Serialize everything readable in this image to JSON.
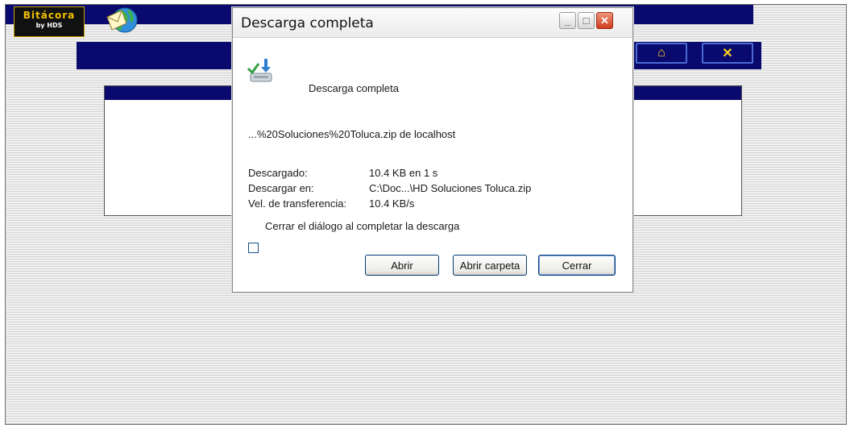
{
  "background_app": {
    "logo_text": "Bitácora",
    "logo_subtext": "by HDS"
  },
  "dialog": {
    "title": "Descarga completa",
    "heading": "Descarga completa",
    "file_source": "...%20Soluciones%20Toluca.zip de localhost",
    "details": [
      {
        "label": "Descargado:",
        "value": "10.4 KB en 1 s"
      },
      {
        "label": "Descargar en:",
        "value": "C:\\Doc...\\HD Soluciones Toluca.zip"
      },
      {
        "label": "Vel. de transferencia:",
        "value": "10.4 KB/s"
      }
    ],
    "close_when_done_label": "Cerrar el diálogo al completar la descarga",
    "close_when_done_checked": false,
    "buttons": {
      "open": "Abrir",
      "open_folder": "Abrir carpeta",
      "close": "Cerrar"
    }
  },
  "colors": {
    "app_navy": "#0a0a6e",
    "nav_accent": "#ffd21a",
    "close_red": "#cf3d1e"
  },
  "icons": [
    "envelope-globe-icon",
    "home-icon",
    "x-icon",
    "download-complete-icon",
    "minimize-icon",
    "maximize-icon",
    "close-icon"
  ]
}
